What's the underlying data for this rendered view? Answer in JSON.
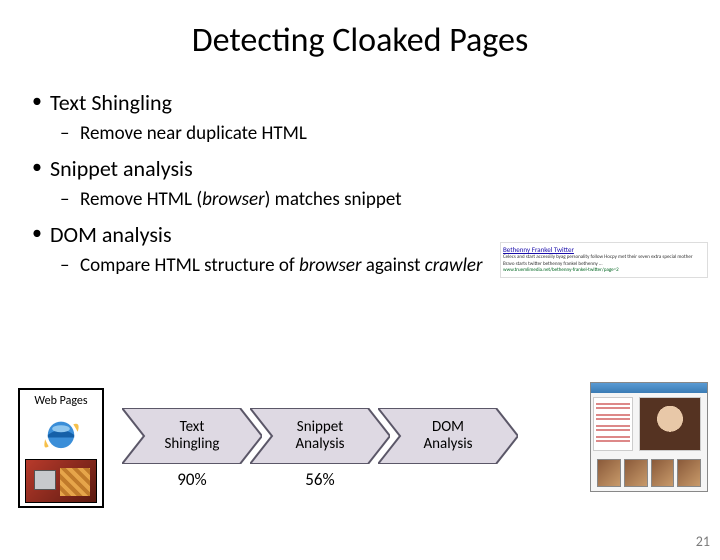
{
  "title": "Detecting Cloaked Pages",
  "bullets": {
    "b1": "Text Shingling",
    "b1_sub": "Remove near duplicate HTML",
    "b2": "Snippet analysis",
    "b2_sub_pre": "Remove HTML (",
    "b2_sub_it": "browser",
    "b2_sub_post": ") matches snippet",
    "b3": "DOM analysis",
    "b3_sub_pre": "Compare HTML structure of ",
    "b3_sub_it1": "browser",
    "b3_sub_mid": " against ",
    "b3_sub_it2": "crawler"
  },
  "snippet_preview": {
    "title": "Bethenny Frankel Twitter",
    "body": "Celecs and start accessiily byag personality follow Hocpy met their seven extra special mother Bravo starts twitter bethenny frankel bethenny ...",
    "url": "www.truemlimedia.net/bethenny-frankel-twitter/page=2"
  },
  "webpages_label": "Web Pages",
  "pipeline": {
    "step1_line1": "Text",
    "step1_line2": "Shingling",
    "step1_pct": "90%",
    "step2_line1": "Snippet",
    "step2_line2": "Analysis",
    "step2_pct": "56%",
    "step3_line1": "DOM",
    "step3_line2": "Analysis"
  },
  "page_number": "21",
  "colors": {
    "chevron_fill": "#ded9e3",
    "chevron_stroke": "#5b5768"
  }
}
